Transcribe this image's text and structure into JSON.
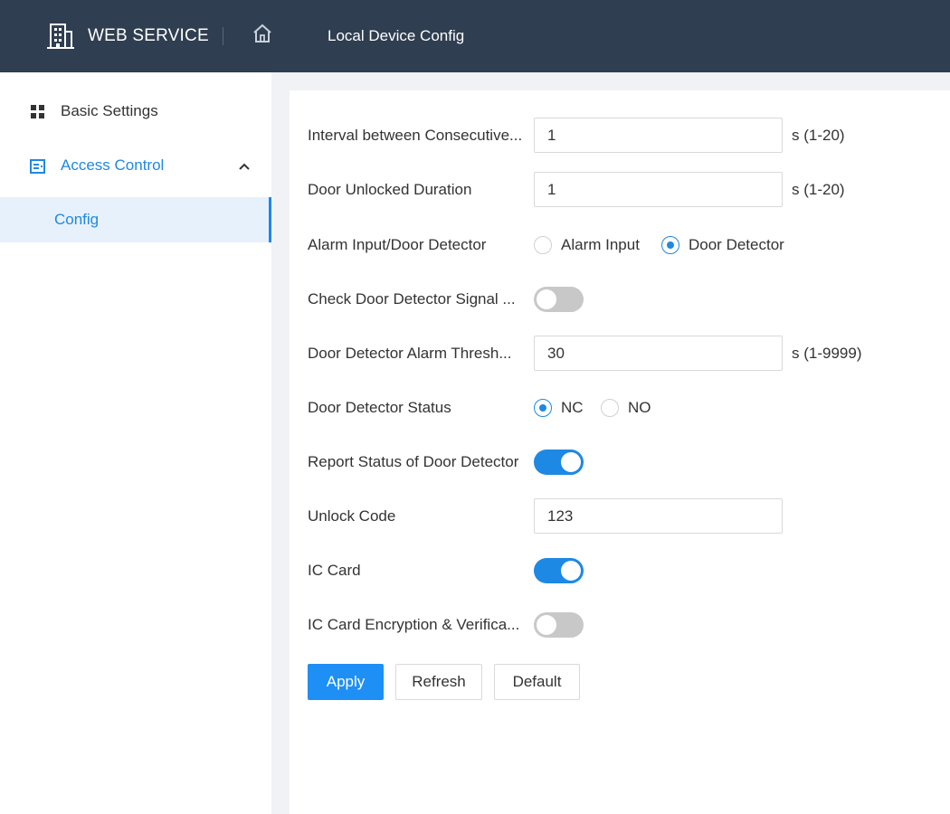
{
  "header": {
    "brand": "WEB SERVICE",
    "breadcrumb": "Local Device Config",
    "colors": {
      "background": "#2f3e50",
      "text": "#ffffff"
    }
  },
  "sidebar": {
    "items": [
      {
        "label": "Basic Settings",
        "icon": "grid-icon"
      },
      {
        "label": "Access Control",
        "icon": "door-icon",
        "expanded": true
      },
      {
        "label": "Config",
        "selected": true
      }
    ]
  },
  "form": {
    "interval": {
      "label": "Interval between Consecutive...",
      "value": "1",
      "unit": "s (1-20)"
    },
    "unlock_duration": {
      "label": "Door Unlocked Duration",
      "value": "1",
      "unit": "s (1-20)"
    },
    "alarm_input_type": {
      "label": "Alarm Input/Door Detector",
      "options": [
        "Alarm Input",
        "Door Detector"
      ],
      "selected": "Door Detector"
    },
    "check_signal": {
      "label": "Check Door Detector Signal ...",
      "enabled": false
    },
    "alarm_threshold": {
      "label": "Door Detector Alarm Thresh...",
      "value": "30",
      "unit": "s (1-9999)"
    },
    "detector_status": {
      "label": "Door Detector Status",
      "options": [
        "NC",
        "NO"
      ],
      "selected": "NC"
    },
    "report_status": {
      "label": "Report Status of Door Detector",
      "enabled": true
    },
    "unlock_code": {
      "label": "Unlock Code",
      "value": "123"
    },
    "ic_card": {
      "label": "IC Card",
      "enabled": true
    },
    "ic_encryption": {
      "label": "IC Card Encryption & Verifica...",
      "enabled": false
    }
  },
  "actions": {
    "apply": "Apply",
    "refresh": "Refresh",
    "default": "Default"
  },
  "colors": {
    "accent": "#1e88e5",
    "toggle_off": "#c8c8c8"
  }
}
